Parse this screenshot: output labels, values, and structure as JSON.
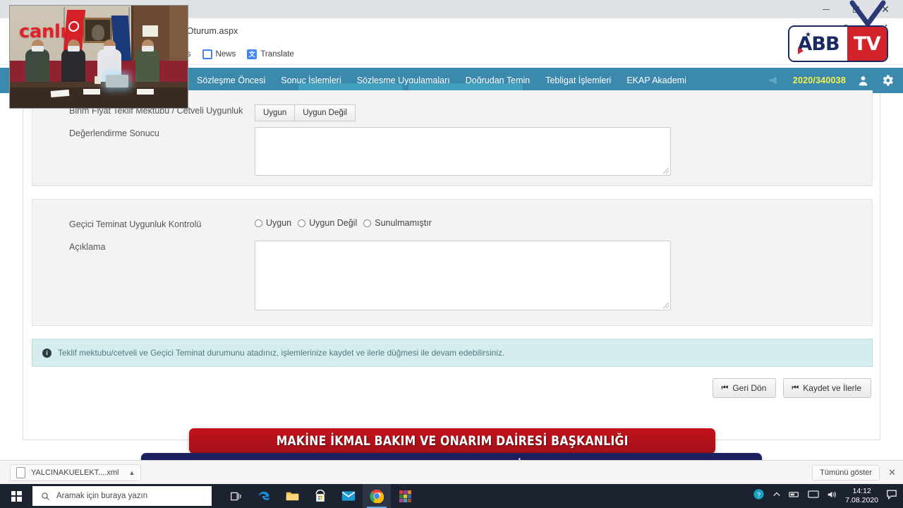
{
  "browser": {
    "url": "IhaleTeklifDegerlendirmeBirinciOturum.aspx",
    "window_controls": {
      "minimize": "minimize-icon",
      "maximize": "maximize-icon",
      "close": "close-icon"
    },
    "bookmarks": [
      {
        "label": "aps",
        "icon": "maps-icon"
      },
      {
        "label": "News",
        "icon": "news-icon"
      },
      {
        "label": "Translate",
        "icon": "translate-icon"
      }
    ],
    "omnibox_icons": [
      "search-icon",
      "star-icon",
      "menu-icon"
    ]
  },
  "app_nav": {
    "items": [
      {
        "label": "Sözleşme Öncesi"
      },
      {
        "label": "Sonuç İşlemleri"
      },
      {
        "label": "Sözleşme Uygulamaları"
      },
      {
        "label": "Doğrudan Temin"
      },
      {
        "label": "Tebligat İşlemleri"
      },
      {
        "label": "EKAP Akademi"
      }
    ],
    "announce_icon": "megaphone-icon",
    "ihale_no": "2020/340038",
    "user_icon": "user-icon",
    "settings_icon": "gear-icon",
    "bar_color": "#3b8aad",
    "ihale_no_color": "#f2f24a"
  },
  "form": {
    "section_one": {
      "teklif_label": "Birim Fiyat Teklif Mektubu / Cetveli Uygunluk",
      "buttons": [
        {
          "label": "Uygun"
        },
        {
          "label": "Uygun Değil"
        }
      ],
      "degerlendirme_label": "Değerlendirme Sonucu",
      "degerlendirme_value": "",
      "degerlendirme_placeholder": ""
    },
    "section_two": {
      "teminat_label": "Geçici Teminat Uygunluk Kontrolü",
      "radios": [
        {
          "label": "Uygun",
          "selected": false
        },
        {
          "label": "Uygun Değil",
          "selected": false
        },
        {
          "label": "Sunulmamıştır",
          "selected": false
        }
      ],
      "aciklama_label": "Açıklama",
      "aciklama_value": "",
      "aciklama_placeholder": ""
    }
  },
  "alert": {
    "icon": "info-icon",
    "message": "Teklif mektubu/cetveli ve Geçici Teminat durumunu atadınız, işlemlerinize kaydet ve ilerle düğmesi ile devam edebilirsiniz.",
    "bg_color": "#d7eced",
    "text_color": "#4e7b80"
  },
  "actions": [
    {
      "label": "Geri Dön",
      "icon": "skip-back-icon"
    },
    {
      "label": "Kaydet ve İlerle",
      "icon": "skip-back-icon"
    }
  ],
  "overlay": {
    "live_label": "canlı",
    "live_color": "#e12029",
    "logo": {
      "text_left": "ABB",
      "text_right": "TV",
      "left_color": "#1b2a63",
      "right_bg": "#d2232a"
    }
  },
  "banners": {
    "top": {
      "text": "MAKİNE İKMAL BAKIM VE ONARIM DAİRESİ BAŞKANLIĞI",
      "color": "#c1131b"
    },
    "bottom": {
      "text": "Muhtelif Akü Mal Alım İşi",
      "color": "#1d2062"
    }
  },
  "download_shelf": {
    "file_name": "YALCINAKUELEKT....xml",
    "file_icon": "document-icon",
    "caret_icon": "chevron-up-icon",
    "show_all_label": "Tümünü göster",
    "close_icon": "close-icon"
  },
  "taskbar": {
    "start_icon": "windows-start-icon",
    "search_placeholder": "Aramak için buraya yazın",
    "search_icon": "search-icon",
    "apps": [
      {
        "name": "task-view-icon"
      },
      {
        "name": "edge-icon"
      },
      {
        "name": "file-explorer-icon"
      },
      {
        "name": "microsoft-store-icon"
      },
      {
        "name": "mail-icon"
      },
      {
        "name": "chrome-icon",
        "active": true
      },
      {
        "name": "winrar-icon"
      }
    ],
    "tray": {
      "help_icon": "help-icon",
      "chevron_icon": "show-hidden-icons",
      "removable_icon": "safely-remove-icon",
      "network_icon": "network-icon",
      "volume_icon": "volume-icon",
      "time": "14:12",
      "date": "7.08.2020",
      "action_center_icon": "action-center-icon"
    }
  }
}
